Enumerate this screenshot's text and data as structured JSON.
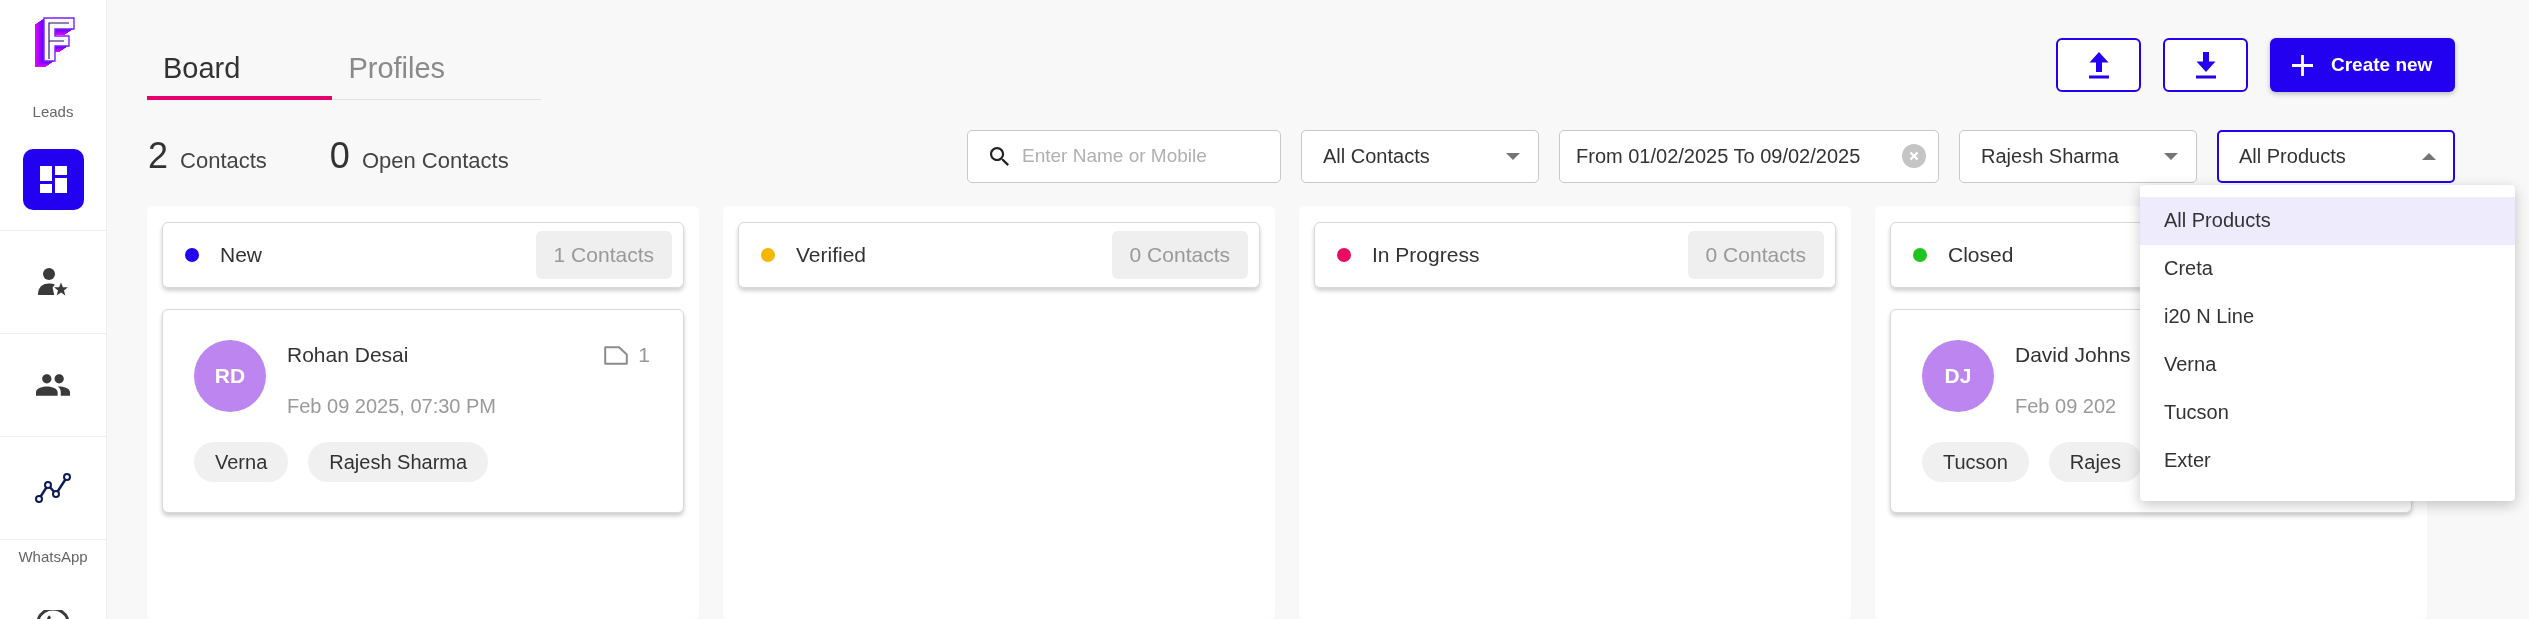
{
  "sidebar": {
    "sections": [
      {
        "label": "Leads",
        "items": [
          {
            "kind": "dashboard",
            "selected": true
          },
          {
            "kind": "personstar",
            "selected": false
          },
          {
            "kind": "people",
            "selected": false
          },
          {
            "kind": "chart",
            "selected": false
          }
        ]
      },
      {
        "label": "WhatsApp",
        "items": [
          {
            "kind": "phone",
            "selected": false
          }
        ]
      }
    ]
  },
  "tabs": [
    {
      "label": "Board",
      "selected": true
    },
    {
      "label": "Profiles",
      "selected": false
    }
  ],
  "actions": [
    {
      "kind": "upload"
    },
    {
      "kind": "download"
    },
    {
      "kind": "create",
      "label": "Create new"
    }
  ],
  "stats": [
    {
      "value": "2",
      "label": "Contacts"
    },
    {
      "value": "0",
      "label": "Open Contacts"
    }
  ],
  "filters": [
    {
      "kind": "search",
      "placeholder": "Enter Name or Mobile"
    },
    {
      "kind": "select",
      "value": "All Contacts",
      "expanded": false
    },
    {
      "kind": "daterange",
      "value": "From 01/02/2025 To 09/02/2025"
    },
    {
      "kind": "select",
      "value": "Rajesh Sharma",
      "expanded": false
    },
    {
      "kind": "select",
      "value": "All Products",
      "expanded": true,
      "options": [
        {
          "label": "All Products",
          "selected": true
        },
        {
          "label": "Creta",
          "selected": false
        },
        {
          "label": "i20 N Line",
          "selected": false
        },
        {
          "label": "Verna",
          "selected": false
        },
        {
          "label": "Tucson",
          "selected": false
        },
        {
          "label": "Exter",
          "selected": false
        }
      ]
    }
  ],
  "board": {
    "columns": [
      {
        "title": "New",
        "color": "#2400f0",
        "count": "1 Contacts",
        "cards": [
          {
            "initials": "RD",
            "name": "Rohan Desai",
            "notes": "1",
            "date": "Feb 09 2025, 07:30 PM",
            "tags": [
              "Verna",
              "Rajesh Sharma"
            ]
          }
        ]
      },
      {
        "title": "Verified",
        "color": "#f5b800",
        "count": "0 Contacts"
      },
      {
        "title": "In Progress",
        "color": "#ea0b63",
        "count": "0 Contacts"
      },
      {
        "title": "Closed",
        "color": "#1fc41f",
        "cards": [
          {
            "initials": "DJ",
            "name": "David Johns",
            "date": "Feb 09 202",
            "tags": [
              "Tucson",
              "Rajes"
            ]
          }
        ]
      }
    ]
  }
}
